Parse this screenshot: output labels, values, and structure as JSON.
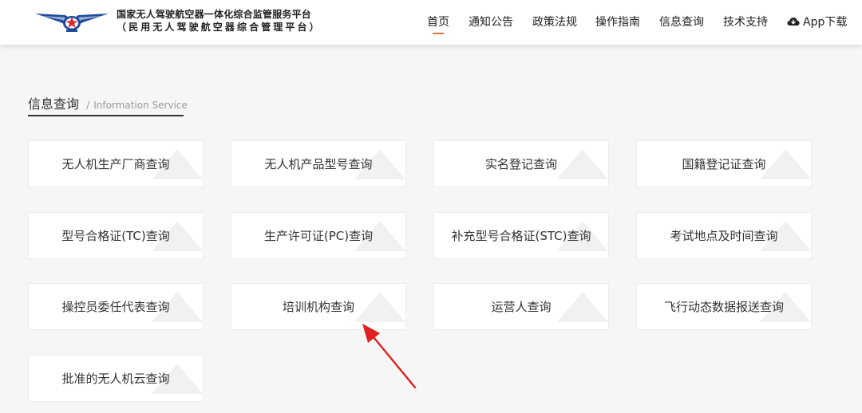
{
  "header": {
    "title": "国家无人驾驶航空器一体化综合监管服务平台",
    "subtitle": "（民用无人驾驶航空器综合管理平台）",
    "nav": [
      {
        "label": "首页",
        "active": true
      },
      {
        "label": "通知公告",
        "active": false
      },
      {
        "label": "政策法规",
        "active": false
      },
      {
        "label": "操作指南",
        "active": false
      },
      {
        "label": "信息查询",
        "active": false
      },
      {
        "label": "技术支持",
        "active": false
      }
    ],
    "app_download": {
      "label": "App下载",
      "icon": "cloud-download-icon"
    },
    "accent_color": "#e0762e"
  },
  "section": {
    "title": "信息查询",
    "separator": "/",
    "subtitle": "Information Service"
  },
  "cards": [
    "无人机生产厂商查询",
    "无人机产品型号查询",
    "实名登记查询",
    "国籍登记证查询",
    "型号合格证(TC)查询",
    "生产许可证(PC)查询",
    "补充型号合格证(STC)查询",
    "考试地点及时间查询",
    "操控员委任代表查询",
    "培训机构查询",
    "运营人查询",
    "飞行动态数据报送查询",
    "批准的无人机云查询"
  ],
  "annotation": {
    "icon": "red-arrow-icon",
    "color": "#e02020"
  }
}
